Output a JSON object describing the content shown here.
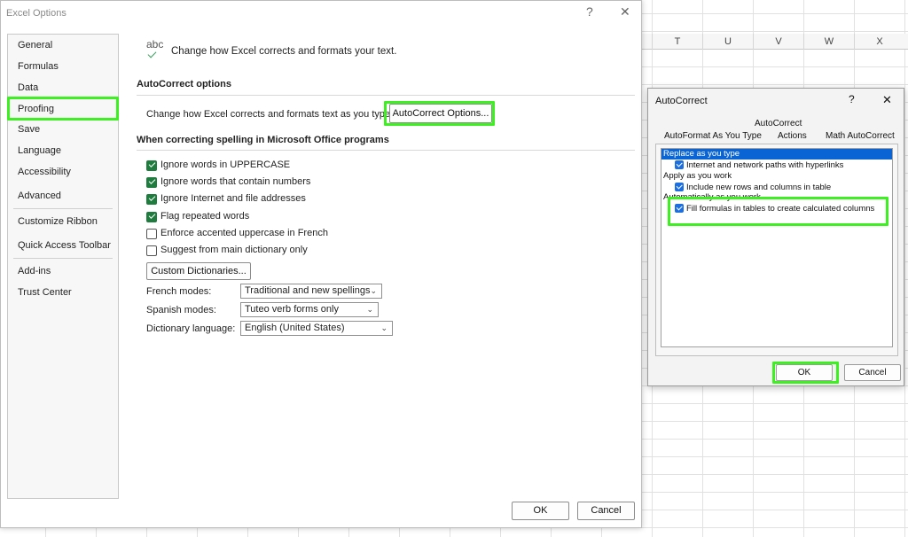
{
  "sheet": {
    "columns": [
      "T",
      "U",
      "V",
      "W",
      "X"
    ]
  },
  "options_window": {
    "title": "Excel Options",
    "help_glyph": "?",
    "close_glyph": "✕",
    "nav": [
      "General",
      "Formulas",
      "Data",
      "Proofing",
      "Save",
      "Language",
      "Accessibility",
      "Advanced",
      "Customize Ribbon",
      "Quick Access Toolbar",
      "Add-ins",
      "Trust Center"
    ],
    "selected_nav": "Proofing",
    "header_icon_text": "abc",
    "header_text": "Change how Excel corrects and formats your text.",
    "autocorrect_section": {
      "title": "AutoCorrect options",
      "label": "Change how Excel corrects and formats text as you type:",
      "button": "AutoCorrect Options..."
    },
    "spelling_section": {
      "title": "When correcting spelling in Microsoft Office programs",
      "checkboxes": [
        {
          "label": "Ignore words in UPPERCASE",
          "checked": true
        },
        {
          "label": "Ignore words that contain numbers",
          "checked": true
        },
        {
          "label": "Ignore Internet and file addresses",
          "checked": true
        },
        {
          "label": "Flag repeated words",
          "checked": true
        },
        {
          "label": "Enforce accented uppercase in French",
          "checked": false
        },
        {
          "label": "Suggest from main dictionary only",
          "checked": false
        }
      ],
      "custom_dict_button": "Custom Dictionaries...",
      "french_modes": {
        "label": "French modes:",
        "value": "Traditional and new spellings"
      },
      "spanish_modes": {
        "label": "Spanish modes:",
        "value": "Tuteo verb forms only"
      },
      "dictionary_language": {
        "label": "Dictionary language:",
        "value": "English (United States)"
      }
    },
    "ok_label": "OK",
    "cancel_label": "Cancel"
  },
  "autocorrect_dialog": {
    "title": "AutoCorrect",
    "help_glyph": "?",
    "close_glyph": "✕",
    "tabs_top": "AutoCorrect",
    "tabs": [
      "AutoFormat As You Type",
      "Actions",
      "Math AutoCorrect"
    ],
    "active_tab": "AutoFormat As You Type",
    "group1_title": "Replace as you type",
    "item1": "Internet and network paths with hyperlinks",
    "group2_title": "Apply as you work",
    "item2": "Include new rows and columns in table",
    "group3_title": "Automatically as you work",
    "item3": "Fill formulas in tables to create calculated columns",
    "ok_label": "OK",
    "cancel_label": "Cancel"
  },
  "colors": {
    "highlight": "#3ef021",
    "excel_green": "#1e7c3e",
    "selection_blue": "#0a64d4"
  }
}
